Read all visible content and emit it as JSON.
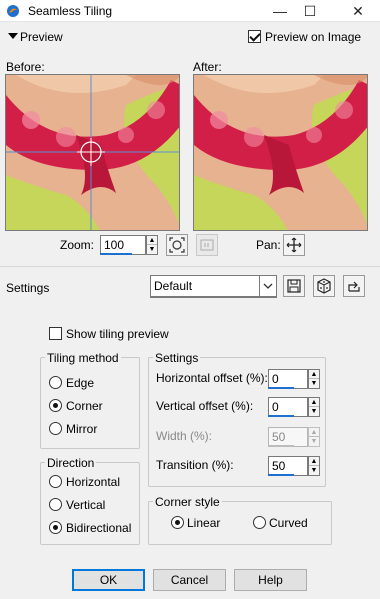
{
  "window": {
    "title": "Seamless Tiling",
    "minimize_glyph": "—",
    "maximize_glyph": "☐",
    "close_glyph": "✕"
  },
  "preview": {
    "header_label": "Preview",
    "preview_on_image_label": "Preview on Image",
    "preview_on_image_checked": true,
    "before_label": "Before:",
    "after_label": "After:",
    "zoom_label": "Zoom:",
    "zoom_value": "100",
    "pan_label": "Pan:"
  },
  "settings_row": {
    "label": "Settings",
    "preset_value": "Default"
  },
  "options": {
    "show_tiling_preview_label": "Show tiling preview",
    "show_tiling_preview_checked": false,
    "tiling_method": {
      "title": "Tiling method",
      "options": [
        "Edge",
        "Corner",
        "Mirror"
      ],
      "selected": "Corner"
    },
    "direction": {
      "title": "Direction",
      "options": [
        "Horizontal",
        "Vertical",
        "Bidirectional"
      ],
      "selected": "Bidirectional"
    },
    "settings": {
      "title": "Settings",
      "horizontal_offset_label": "Horizontal offset (%):",
      "horizontal_offset_value": "0",
      "vertical_offset_label": "Vertical offset (%):",
      "vertical_offset_value": "0",
      "width_label": "Width (%):",
      "width_value": "50",
      "transition_label": "Transition (%):",
      "transition_value": "50"
    },
    "corner_style": {
      "title": "Corner style",
      "options": [
        "Linear",
        "Curved"
      ],
      "selected": "Linear"
    }
  },
  "buttons": {
    "ok": "OK",
    "cancel": "Cancel",
    "help": "Help"
  },
  "colors": {
    "accent": "#0078d7",
    "underline": "#1f6fce",
    "bikini": "#d8214b",
    "background_yellow": "#c5d65a",
    "skin": "#e6b08c"
  }
}
